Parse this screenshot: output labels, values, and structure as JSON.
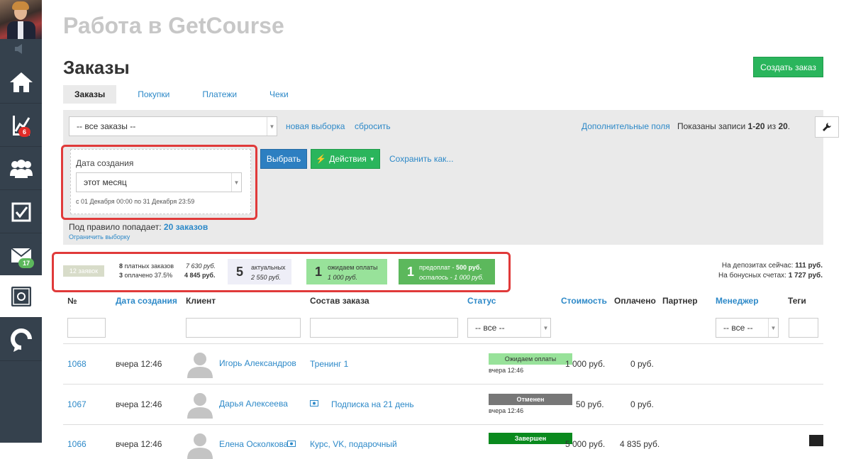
{
  "page": {
    "title": "Работа в GetCourse",
    "heading": "Заказы",
    "create_button": "Создать заказ"
  },
  "sidebar": {
    "badges": {
      "stats": "6",
      "mail": "17"
    },
    "icons": [
      "home-icon",
      "chart-icon",
      "users-icon",
      "tasks-icon",
      "mail-icon",
      "safe-icon",
      "getcourse-logo-icon"
    ]
  },
  "tabs": [
    "Заказы",
    "Покупки",
    "Платежи",
    "Чеки"
  ],
  "filter": {
    "segment_select": "-- все заказы --",
    "new_selection": "новая выборка",
    "reset": "сбросить",
    "extra_fields": "Дополнительные поля",
    "records_prefix": "Показаны записи ",
    "records_range": "1-20",
    "records_mid": " из ",
    "records_total": "20",
    "records_suffix": ".",
    "date_label": "Дата создания",
    "date_select": "этот месяц",
    "date_range": "с 01 Декабря 00:00 по 31 Декабря 23:59",
    "choose_button": "Выбрать",
    "actions_button": "Действия",
    "save_as": "Сохранить как...",
    "rule_prefix": "Под правило попадает: ",
    "rule_count": "20 заказов",
    "limit_selection": "Ограничить выборку"
  },
  "stats": {
    "requests": "12 заявок",
    "paid_count": "8",
    "paid_label": "платных заказов",
    "paid_sum": "7 630 руб.",
    "paid_pct_count": "3",
    "paid_pct_label": "оплачено 37.5%",
    "paid_pct_sum": "4 845 руб.",
    "actual_count": "5",
    "actual_label": "актуальных",
    "actual_sum": "2 550 руб.",
    "waiting_count": "1",
    "waiting_label": "ожидаем оплаты",
    "waiting_sum": "1 000 руб.",
    "prepaid_count": "1",
    "prepaid_label": "предоплат - ",
    "prepaid_amount": "500 руб.",
    "prepaid_rest": "осталось - 1 000 руб.",
    "deposit_label": "На депозитах сейчас: ",
    "deposit_value": "111 руб.",
    "bonus_label": "На бонусных счетах: ",
    "bonus_value": "1 727 руб."
  },
  "table": {
    "headers": [
      "№",
      "Дата создания",
      "Клиент",
      "Состав заказа",
      "Статус",
      "Стоимость",
      "Оплачено",
      "Партнер",
      "Менеджер",
      "Теги"
    ],
    "status_filter": "-- все --",
    "manager_filter": "-- все --",
    "rows": [
      {
        "id": "1068",
        "date": "вчера 12:46",
        "client": "Игорь Александров",
        "product": "Тренинг 1",
        "status": "Ожидаем оплаты",
        "status_date": "вчера 12:46",
        "cost": "1 000 руб.",
        "paid": "0 руб."
      },
      {
        "id": "1067",
        "date": "вчера 12:46",
        "client": "Дарья Алексеева",
        "product": "Подписка на 21 день",
        "status": "Отменен",
        "status_date": "вчера 12:46",
        "cost": "50 руб.",
        "paid": "0 руб."
      },
      {
        "id": "1066",
        "date": "вчера 12:46",
        "client": "Елена Осколкова",
        "product": "Курс, VK, подарочный",
        "status": "Завершен",
        "status_date": "",
        "cost": "5 000 руб.",
        "paid": "4 835 руб."
      }
    ]
  },
  "colors": {
    "sidebar": "#35414d",
    "link": "#2d89c8",
    "green": "#2ab55c",
    "highlight": "#e03a3a"
  }
}
